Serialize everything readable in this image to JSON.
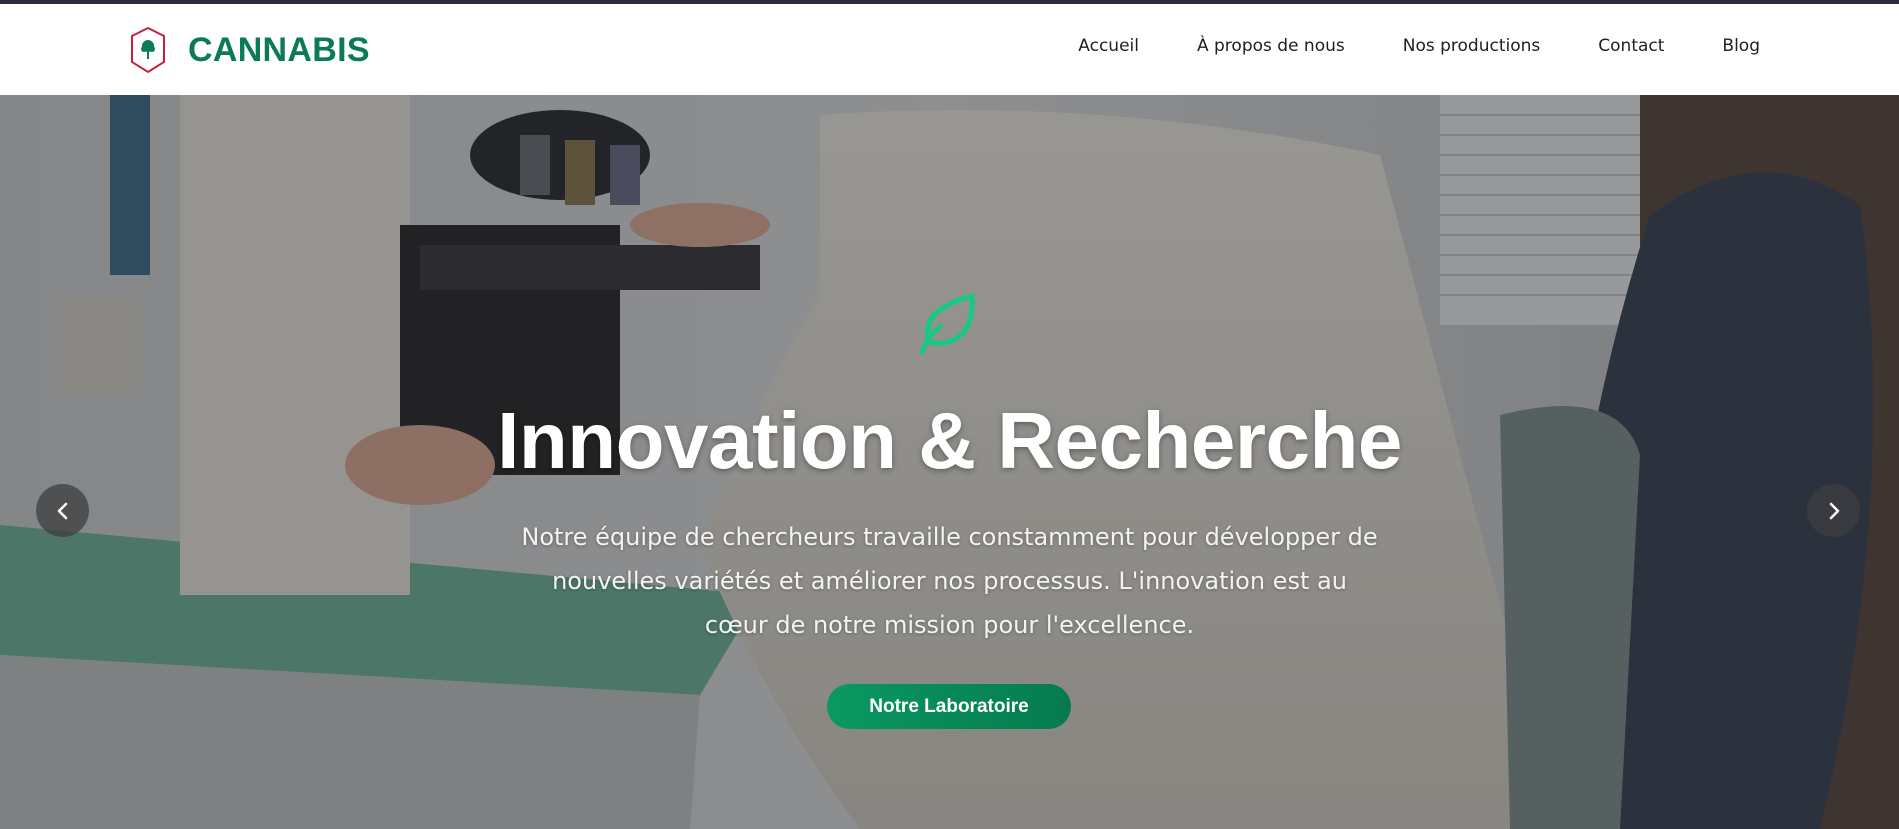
{
  "brand": {
    "name": "CANNABIS",
    "color": "#0b7b54",
    "logo_icon": "shield-leaf-icon"
  },
  "nav": {
    "items": [
      {
        "label": "Accueil"
      },
      {
        "label": "À propos de nous"
      },
      {
        "label": "Nos productions"
      },
      {
        "label": "Contact"
      },
      {
        "label": "Blog"
      }
    ]
  },
  "hero": {
    "icon": "leaf-icon",
    "title": "Innovation & Recherche",
    "text": "Notre équipe de chercheurs travaille constamment pour développer de nouvelles variétés et améliorer nos processus. L'innovation est au cœur de notre mission pour l'excellence.",
    "button_label": "Notre Laboratoire",
    "accent_color": "#0a9962",
    "prev_icon": "chevron-left-icon",
    "next_icon": "chevron-right-icon"
  }
}
